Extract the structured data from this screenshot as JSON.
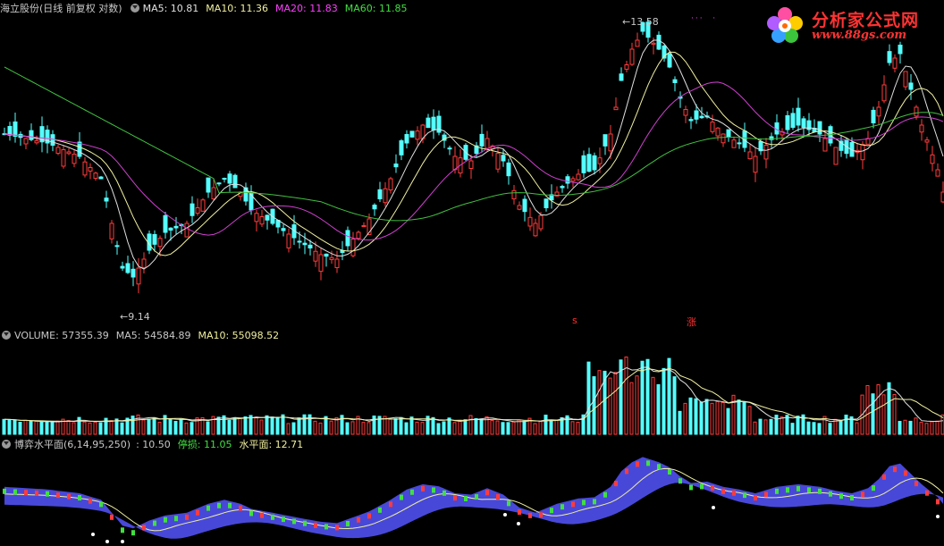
{
  "price_panel": {
    "stock_name": "海立股份",
    "period": "(日线 前复权 对数)",
    "ma": [
      {
        "label": "MA5: 10.81",
        "color": "#e0e0e0"
      },
      {
        "label": "MA10: 11.36",
        "color": "#f0f0a0"
      },
      {
        "label": "MA20: 11.83",
        "color": "#ff40ff"
      },
      {
        "label": "MA60: 11.85",
        "color": "#40e040"
      }
    ],
    "high_label": "13.58",
    "low_label": "9.14",
    "marker_s": "s",
    "marker_zhang": "涨"
  },
  "volume_panel": {
    "items": [
      {
        "label": "VOLUME: 57355.39",
        "color": "#c8c8c8"
      },
      {
        "label": "MA5: 54584.89",
        "color": "#c8c8c8"
      },
      {
        "label": "MA10: 55098.52",
        "color": "#f0f0a0"
      }
    ]
  },
  "indicator_panel": {
    "name": "博弈水平面",
    "params": "(6,14,95,250)",
    "items": [
      {
        "label": ": 10.50",
        "color": "#c8c8c8"
      },
      {
        "label": "停损: 11.05",
        "color": "#40e040"
      },
      {
        "label": "水平面: 12.71",
        "color": "#f0f0a0"
      }
    ]
  },
  "logo": {
    "text": "分析家公式网",
    "url": "www.88gs.com"
  },
  "colors": {
    "up": "#ff3b3b",
    "down": "#54ffff",
    "ma5": "#e0e0e0",
    "ma10": "#f0f0a0",
    "ma20": "#d040d0",
    "ma60": "#40c040",
    "water": "#4848d8"
  }
}
